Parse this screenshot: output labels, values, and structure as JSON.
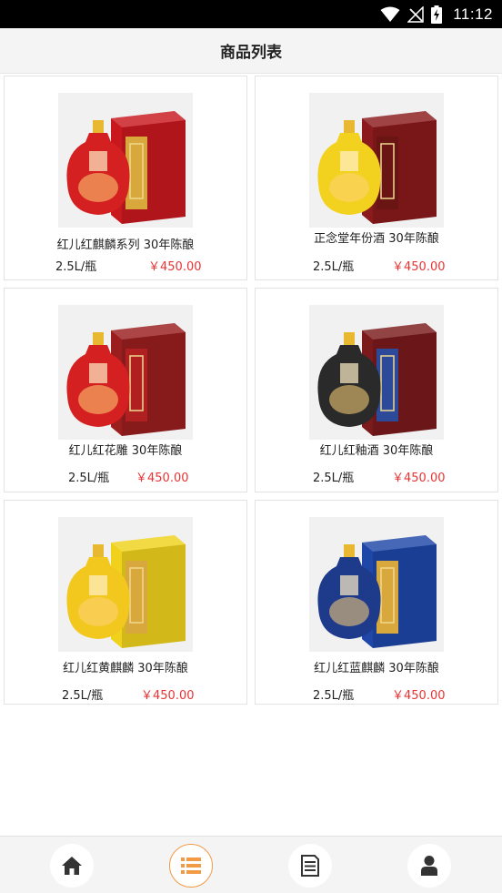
{
  "status_bar": {
    "time": "11:12"
  },
  "header": {
    "title": "商品列表"
  },
  "products": [
    {
      "name": "红儿红麒麟系列 30年陈酿",
      "unit": "2.5L/瓶",
      "price": "￥450.00",
      "bottle_color": "#d42020",
      "box_color": "#c8181e",
      "panel_color": "#d8a83c"
    },
    {
      "name": "正念堂年份酒 30年陈酿",
      "unit": "2.5L/瓶",
      "price": "￥450.00",
      "bottle_color": "#f2d21e",
      "box_color": "#8a1a1c",
      "panel_color": "#6b1414"
    },
    {
      "name": "红儿红花雕 30年陈酿",
      "unit": "2.5L/瓶",
      "price": "￥450.00",
      "bottle_color": "#d42020",
      "box_color": "#9a1e1e",
      "panel_color": "#b02020"
    },
    {
      "name": "红儿红釉酒 30年陈酿",
      "unit": "2.5L/瓶",
      "price": "￥450.00",
      "bottle_color": "#2a2a2a",
      "box_color": "#7a1a1c",
      "panel_color": "#2d4a9a"
    },
    {
      "name": "红儿红黄麒麟 30年陈酿",
      "unit": "2.5L/瓶",
      "price": "￥450.00",
      "bottle_color": "#f2c81e",
      "box_color": "#f0d21c",
      "panel_color": "#d8a83c"
    },
    {
      "name": "红儿红蓝麒麟 30年陈酿",
      "unit": "2.5L/瓶",
      "price": "￥450.00",
      "bottle_color": "#1e3a8a",
      "box_color": "#1e47a8",
      "panel_color": "#d8a83c"
    }
  ],
  "tabs": [
    {
      "name": "home",
      "icon": "home-icon"
    },
    {
      "name": "list",
      "icon": "list-icon"
    },
    {
      "name": "orders",
      "icon": "document-icon"
    },
    {
      "name": "profile",
      "icon": "user-icon"
    }
  ],
  "colors": {
    "accent": "#f29a45",
    "price": "#e63434"
  }
}
